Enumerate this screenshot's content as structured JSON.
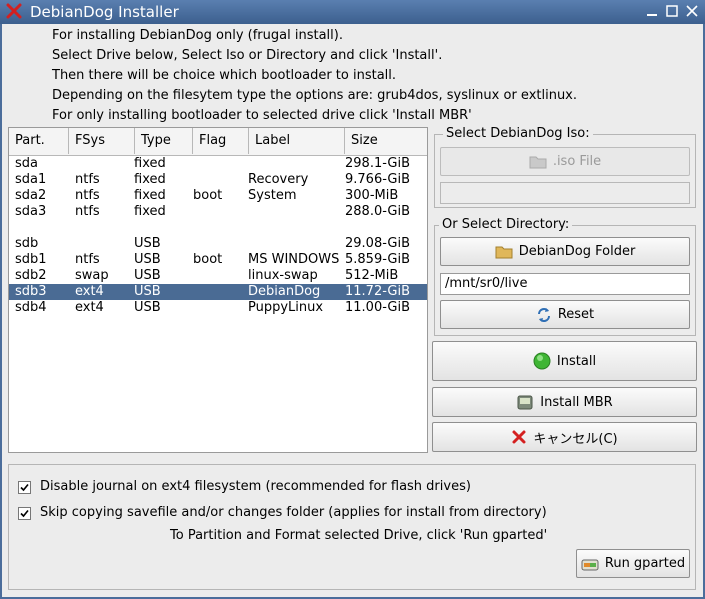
{
  "window": {
    "title": "DebianDog Installer"
  },
  "intro": [
    "For installing DebianDog only (frugal install).",
    "Select Drive below, Select Iso or Directory and click 'Install'.",
    "Then there will be choice which bootloader to install.",
    "Depending on the filesytem type the options are: grub4dos, syslinux or extlinux.",
    "For only installing bootloader to selected drive click 'Install MBR'"
  ],
  "table": {
    "columns": [
      "Part.",
      "FSys",
      "Type",
      "Flag",
      "Label",
      "Size"
    ],
    "rows": [
      [
        "sda",
        "",
        "fixed",
        "",
        "",
        "298.1-GiB"
      ],
      [
        "sda1",
        "ntfs",
        "fixed",
        "",
        "Recovery",
        "9.766-GiB"
      ],
      [
        "sda2",
        "ntfs",
        "fixed",
        "boot",
        "System",
        "300-MiB"
      ],
      [
        "sda3",
        "ntfs",
        "fixed",
        "",
        "",
        "288.0-GiB"
      ],
      [
        "",
        "",
        "",
        "",
        "",
        ""
      ],
      [
        "sdb",
        "",
        "USB",
        "",
        "",
        "29.08-GiB"
      ],
      [
        "sdb1",
        "ntfs",
        "USB",
        "boot",
        "MS WINDOWS",
        "5.859-GiB"
      ],
      [
        "sdb2",
        "swap",
        "USB",
        "",
        "linux-swap",
        "512-MiB"
      ],
      [
        "sdb3",
        "ext4",
        "USB",
        "",
        "DebianDog",
        "11.72-GiB"
      ],
      [
        "sdb4",
        "ext4",
        "USB",
        "",
        "PuppyLinux",
        "11.00-GiB"
      ]
    ],
    "selected_index": 8
  },
  "iso": {
    "group_label": "Select DebianDog Iso:",
    "button_label": ".iso File",
    "value": ""
  },
  "dir": {
    "group_label": "Or Select Directory:",
    "button_label": "DebianDog Folder",
    "value": "/mnt/sr0/live",
    "reset_label": "Reset"
  },
  "actions": {
    "install_label": "Install",
    "install_mbr_label": "Install MBR",
    "cancel_label": "キャンセル(C)"
  },
  "options": {
    "disable_journal": {
      "label": "Disable journal on ext4 filesystem (recommended for flash drives)",
      "checked": true
    },
    "skip_copy": {
      "label": "Skip copying savefile and/or changes folder (applies for install from directory)",
      "checked": true
    },
    "gparted_hint": "To Partition and Format selected Drive, click 'Run gparted'",
    "gparted_label": "Run gparted"
  }
}
